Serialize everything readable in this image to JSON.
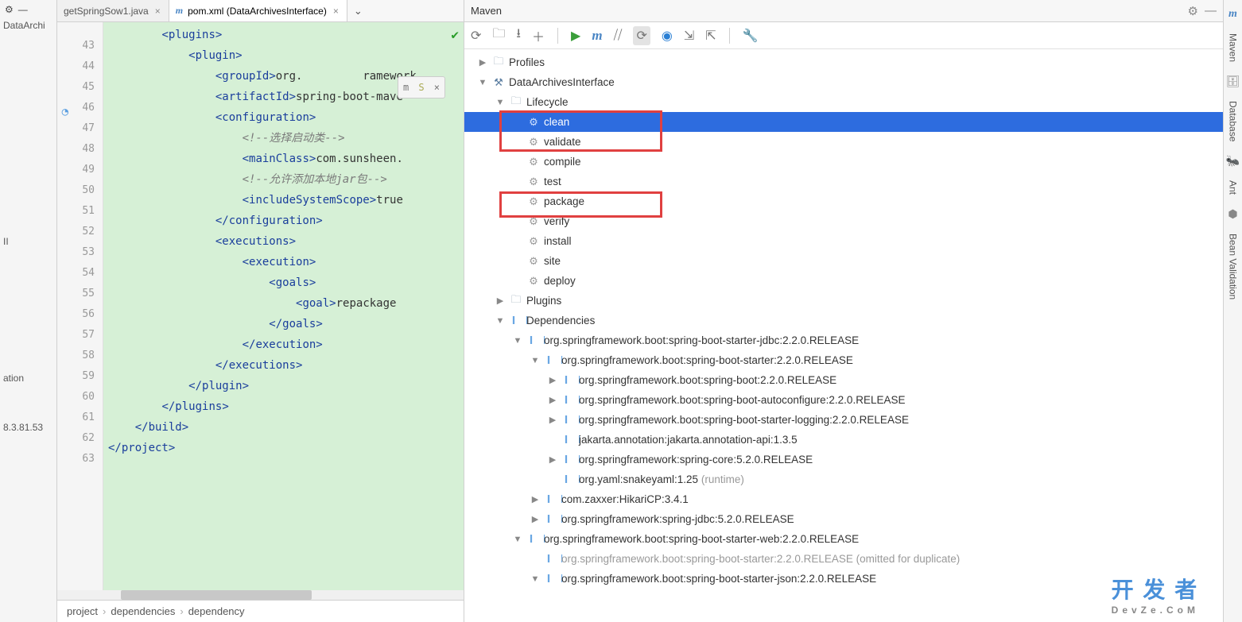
{
  "leftStrip": {
    "item1": "DataArchi",
    "item2": "II",
    "item3": "ation",
    "item4": "8.3.81.53"
  },
  "tabs": {
    "t1": "getSpringSow1.java",
    "t2": "pom.xml (DataArchivesInterface)"
  },
  "code": {
    "lines": [
      {
        "n": 43,
        "html": "        <span class='tg'>&lt;</span><span class='tn'>plugins</span><span class='tg'>&gt;</span>"
      },
      {
        "n": 44,
        "html": "            <span class='tg'>&lt;</span><span class='tn'>plugin</span><span class='tg'>&gt;</span>"
      },
      {
        "n": 45,
        "html": "                <span class='tg'>&lt;</span><span class='tn'>groupId</span><span class='tg'>&gt;</span><span class='tx'>org.         ramework</span>"
      },
      {
        "n": 46,
        "html": "                <span class='tg'>&lt;</span><span class='tn'>artifactId</span><span class='tg'>&gt;</span><span class='tx'>spring-boot-mave</span>"
      },
      {
        "n": 47,
        "html": "                <span class='tg'>&lt;</span><span class='tn'>configuration</span><span class='tg'>&gt;</span>"
      },
      {
        "n": 48,
        "html": "                    <span class='cm'>&lt;!--选择启动类--&gt;</span>"
      },
      {
        "n": 49,
        "html": "                    <span class='tg'>&lt;</span><span class='tn'>mainClass</span><span class='tg'>&gt;</span><span class='tx'>com.sunsheen.</span>"
      },
      {
        "n": 50,
        "html": "                    <span class='cm'>&lt;!--允许添加本地jar包--&gt;</span>"
      },
      {
        "n": 51,
        "html": "                    <span class='tg'>&lt;</span><span class='tn'>includeSystemScope</span><span class='tg'>&gt;</span><span class='tx'>true</span>"
      },
      {
        "n": 52,
        "html": "                <span class='tg'>&lt;/</span><span class='tn'>configuration</span><span class='tg'>&gt;</span>"
      },
      {
        "n": 53,
        "html": "                <span class='tg'>&lt;</span><span class='tn'>executions</span><span class='tg'>&gt;</span>"
      },
      {
        "n": 54,
        "html": "                    <span class='tg'>&lt;</span><span class='tn'>execution</span><span class='tg'>&gt;</span>"
      },
      {
        "n": 55,
        "html": "                        <span class='tg'>&lt;</span><span class='tn'>goals</span><span class='tg'>&gt;</span>"
      },
      {
        "n": 56,
        "html": "                            <span class='tg'>&lt;</span><span class='tn'>goal</span><span class='tg'>&gt;</span><span class='tx'>repackage</span>"
      },
      {
        "n": 57,
        "html": "                        <span class='tg'>&lt;/</span><span class='tn'>goals</span><span class='tg'>&gt;</span>"
      },
      {
        "n": 58,
        "html": "                    <span class='tg'>&lt;/</span><span class='tn'>execution</span><span class='tg'>&gt;</span>"
      },
      {
        "n": 59,
        "html": "                <span class='tg'>&lt;/</span><span class='tn'>executions</span><span class='tg'>&gt;</span>"
      },
      {
        "n": 60,
        "html": "            <span class='tg'>&lt;/</span><span class='tn'>plugin</span><span class='tg'>&gt;</span>"
      },
      {
        "n": 61,
        "html": "        <span class='tg'>&lt;/</span><span class='tn'>plugins</span><span class='tg'>&gt;</span>"
      },
      {
        "n": 62,
        "html": "    <span class='tg'>&lt;/</span><span class='tn'>build</span><span class='tg'>&gt;</span>"
      },
      {
        "n": 63,
        "html": "<span class='tg'>&lt;/</span><span class='tn'>project</span><span class='tg'>&gt;</span>"
      }
    ]
  },
  "breadcrumb": {
    "b1": "project",
    "b2": "dependencies",
    "b3": "dependency"
  },
  "maven": {
    "title": "Maven",
    "tree": [
      {
        "d": 0,
        "tw": "▶",
        "ico": "folder",
        "lbl": "Profiles"
      },
      {
        "d": 0,
        "tw": "▼",
        "ico": "prj",
        "lbl": "DataArchivesInterface"
      },
      {
        "d": 1,
        "tw": "▼",
        "ico": "folder",
        "lbl": "Lifecycle"
      },
      {
        "d": 2,
        "tw": "",
        "ico": "gear",
        "lbl": "clean",
        "sel": true
      },
      {
        "d": 2,
        "tw": "",
        "ico": "gear",
        "lbl": "validate"
      },
      {
        "d": 2,
        "tw": "",
        "ico": "gear",
        "lbl": "compile"
      },
      {
        "d": 2,
        "tw": "",
        "ico": "gear",
        "lbl": "test"
      },
      {
        "d": 2,
        "tw": "",
        "ico": "gear",
        "lbl": "package"
      },
      {
        "d": 2,
        "tw": "",
        "ico": "gear",
        "lbl": "verify"
      },
      {
        "d": 2,
        "tw": "",
        "ico": "gear",
        "lbl": "install"
      },
      {
        "d": 2,
        "tw": "",
        "ico": "gear",
        "lbl": "site"
      },
      {
        "d": 2,
        "tw": "",
        "ico": "gear",
        "lbl": "deploy"
      },
      {
        "d": 1,
        "tw": "▶",
        "ico": "folder",
        "lbl": "Plugins"
      },
      {
        "d": 1,
        "tw": "▼",
        "ico": "lib",
        "lbl": "Dependencies"
      },
      {
        "d": 2,
        "tw": "▼",
        "ico": "lib",
        "lbl": "org.springframework.boot:spring-boot-starter-jdbc:2.2.0.RELEASE"
      },
      {
        "d": 3,
        "tw": "▼",
        "ico": "lib",
        "lbl": "org.springframework.boot:spring-boot-starter:2.2.0.RELEASE"
      },
      {
        "d": 4,
        "tw": "▶",
        "ico": "lib",
        "lbl": "org.springframework.boot:spring-boot:2.2.0.RELEASE"
      },
      {
        "d": 4,
        "tw": "▶",
        "ico": "lib",
        "lbl": "org.springframework.boot:spring-boot-autoconfigure:2.2.0.RELEASE"
      },
      {
        "d": 4,
        "tw": "▶",
        "ico": "lib",
        "lbl": "org.springframework.boot:spring-boot-starter-logging:2.2.0.RELEASE"
      },
      {
        "d": 4,
        "tw": "",
        "ico": "lib",
        "lbl": "jakarta.annotation:jakarta.annotation-api:1.3.5"
      },
      {
        "d": 4,
        "tw": "▶",
        "ico": "lib",
        "lbl": "org.springframework:spring-core:5.2.0.RELEASE"
      },
      {
        "d": 4,
        "tw": "",
        "ico": "lib",
        "lbl": "org.yaml:snakeyaml:1.25",
        "suffix": "(runtime)"
      },
      {
        "d": 3,
        "tw": "▶",
        "ico": "lib",
        "lbl": "com.zaxxer:HikariCP:3.4.1"
      },
      {
        "d": 3,
        "tw": "▶",
        "ico": "lib",
        "lbl": "org.springframework:spring-jdbc:5.2.0.RELEASE"
      },
      {
        "d": 2,
        "tw": "▼",
        "ico": "lib",
        "lbl": "org.springframework.boot:spring-boot-starter-web:2.2.0.RELEASE"
      },
      {
        "d": 3,
        "tw": "",
        "ico": "lib",
        "lbl": "org.springframework.boot:spring-boot-starter:2.2.0.RELEASE (omitted for duplicate)",
        "omit": true
      },
      {
        "d": 3,
        "tw": "▼",
        "ico": "lib",
        "lbl": "org.springframework.boot:spring-boot-starter-json:2.2.0.RELEASE"
      }
    ]
  },
  "rightTabs": {
    "t1": "Maven",
    "t2": "Database",
    "t3": "Ant",
    "t4": "Bean Validation"
  },
  "watermark": {
    "main": "开 发 者",
    "sub": "DevZe.CoM"
  }
}
